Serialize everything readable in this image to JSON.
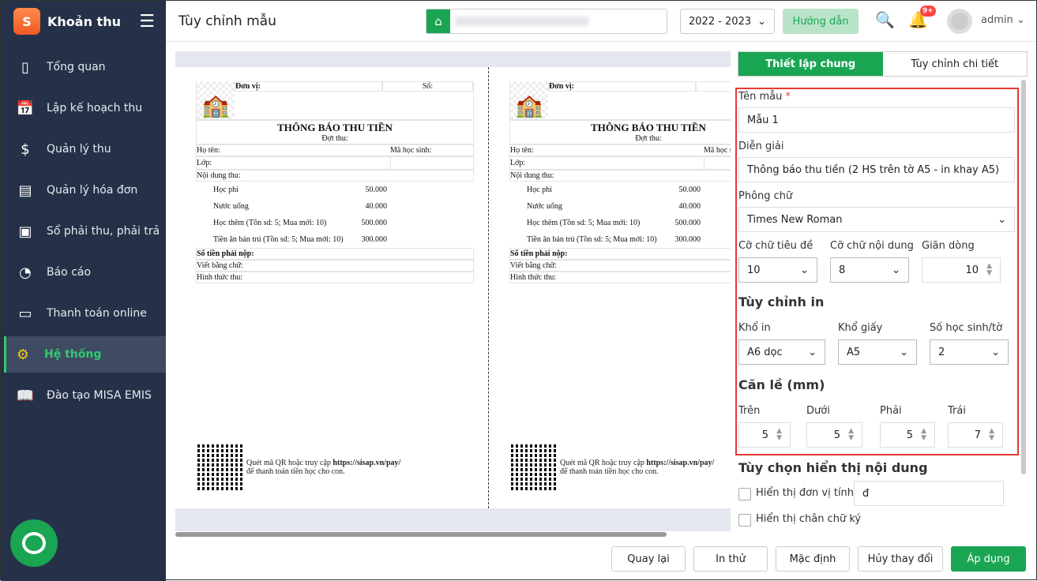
{
  "app": {
    "title": "Khoản thu",
    "logo_text": "S"
  },
  "sidebar": {
    "items": [
      {
        "label": "Tổng quan",
        "icon": "bar-chart-icon"
      },
      {
        "label": "Lập kế hoạch thu",
        "icon": "calendar-dollar-icon"
      },
      {
        "label": "Quản lý thu",
        "icon": "hand-coin-icon"
      },
      {
        "label": "Quản lý hóa đơn",
        "icon": "invoice-icon"
      },
      {
        "label": "Sổ phải thu, phải trả",
        "icon": "ledger-icon"
      },
      {
        "label": "Báo cáo",
        "icon": "pie-chart-icon"
      },
      {
        "label": "Thanh toán online",
        "icon": "card-check-icon"
      },
      {
        "label": "Hệ thống",
        "icon": "gear-icon",
        "active": true
      },
      {
        "label": "Đào tạo MISA EMIS",
        "icon": "book-icon"
      }
    ]
  },
  "header": {
    "title": "Tùy chỉnh mẫu",
    "year": "2022 - 2023",
    "guide": "Hướng dẫn",
    "badge": "9+",
    "user": "admin"
  },
  "receipt": {
    "don_vi": "Đơn vị:",
    "so": "Số:",
    "title": "THÔNG BÁO THU TIỀN",
    "dot_thu": "Đợt thu:",
    "ho_ten": "Họ tên:",
    "ma_hs": "Mã học sinh:",
    "lop": "Lớp:",
    "noi_dung": "Nội dung thu:",
    "items": [
      {
        "name": "Học phí",
        "amount": "50.000"
      },
      {
        "name": "Nước uống",
        "amount": "40.000"
      },
      {
        "name": "Học thêm (Tồn sd: 5; Mua mới: 10)",
        "amount": "500.000"
      },
      {
        "name": "Tiền ăn bán trú (Tồn sd: 5; Mua mới: 10)",
        "amount": "300.000"
      }
    ],
    "so_tien": "Số tiền phải nộp:",
    "viet_bang_chu": "Viết bằng chữ:",
    "hinh_thuc": "Hình thức thu:",
    "qr_text1": "Quét mã QR hoặc truy cập ",
    "qr_url": "https://sisap.vn/pay/",
    "qr_text2": "để thanh toán tiền học cho con."
  },
  "panel": {
    "tabs": [
      "Thiết lập chung",
      "Tùy chỉnh chi tiết"
    ],
    "ten_mau_label": "Tên mẫu",
    "required": "*",
    "ten_mau": "Mẫu 1",
    "dien_giai_label": "Diễn giải",
    "dien_giai": "Thông báo thu tiền (2 HS trên tờ A5 - in khay A5)",
    "phong_chu_label": "Phông chữ",
    "phong_chu": "Times New Roman",
    "co_chu_tieu_de_label": "Cỡ chữ tiêu đề",
    "co_chu_tieu_de": "10",
    "co_chu_noi_dung_label": "Cỡ chữ nội dung",
    "co_chu_noi_dung": "8",
    "gian_dong_label": "Giãn dòng",
    "gian_dong": "10",
    "tuy_chinh_in": "Tùy chỉnh in",
    "kho_in_label": "Khổ in",
    "kho_in": "A6 dọc",
    "kho_giay_label": "Khổ giấy",
    "kho_giay": "A5",
    "so_hs_label": "Số học sinh/tờ",
    "so_hs": "2",
    "can_le": "Căn lề (mm)",
    "tren_label": "Trên",
    "tren": "5",
    "duoi_label": "Dưới",
    "duoi": "5",
    "phai_label": "Phải",
    "phai": "5",
    "trai_label": "Trái",
    "trai": "7",
    "tuy_chon": "Tùy chọn hiển thị nội dung",
    "don_vi_tinh_label": "Hiển thị đơn vị tính",
    "don_vi_tinh": "đ",
    "chan_chu_ky_label": "Hiển thị chân chữ ký"
  },
  "footer": {
    "back": "Quay lại",
    "test_print": "In thử",
    "default": "Mặc định",
    "cancel": "Hủy thay đổi",
    "apply": "Áp dụng"
  }
}
